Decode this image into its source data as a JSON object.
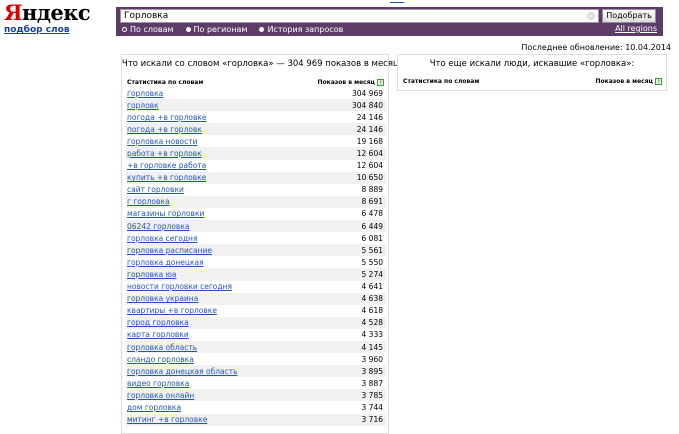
{
  "logo": {
    "word_first": "Я",
    "word_rest": "ндекс",
    "subtitle": "подбор слов"
  },
  "search": {
    "value": "Горловка",
    "button_label": "Подобрать",
    "modes": [
      {
        "label": "По словам",
        "selected": true
      },
      {
        "label": "По регионам",
        "selected": false
      },
      {
        "label": "История запросов",
        "selected": false
      }
    ],
    "all_regions_label": "All regions"
  },
  "last_update": "Последнее обновление: 10.04.2014",
  "left_panel": {
    "title": "Что искали со словом «горловка» — 304 969 показов в месяц",
    "col_query": "Статистика по словам",
    "col_shows": "Показов в месяц",
    "rows": [
      {
        "q": "горловка",
        "n": "304 969"
      },
      {
        "q": "горловк",
        "n": "304 840"
      },
      {
        "q": "погода +в горловке",
        "n": "24 146"
      },
      {
        "q": "погода +в горловк",
        "n": "24 146"
      },
      {
        "q": "горловка новости",
        "n": "19 168"
      },
      {
        "q": "работа +в горловк",
        "n": "12 604"
      },
      {
        "q": "+в горловке работа",
        "n": "12 604"
      },
      {
        "q": "купить +в горловке",
        "n": "10 650"
      },
      {
        "q": "сайт горловки",
        "n": "8 889"
      },
      {
        "q": "г горловка",
        "n": "8 691"
      },
      {
        "q": "магазины горловки",
        "n": "6 478"
      },
      {
        "q": "06242 горловка",
        "n": "6 449"
      },
      {
        "q": "горловка сегодня",
        "n": "6 081"
      },
      {
        "q": "горловка расписание",
        "n": "5 561"
      },
      {
        "q": "горловка донецкая",
        "n": "5 550"
      },
      {
        "q": "горловка юа",
        "n": "5 274"
      },
      {
        "q": "новости горловки сегодня",
        "n": "4 641"
      },
      {
        "q": "горловка украина",
        "n": "4 638"
      },
      {
        "q": "квартиры +в горловке",
        "n": "4 618"
      },
      {
        "q": "город горловка",
        "n": "4 528"
      },
      {
        "q": "карта горловки",
        "n": "4 333"
      },
      {
        "q": "горловка область",
        "n": "4 145"
      },
      {
        "q": "сландо горловка",
        "n": "3 960"
      },
      {
        "q": "горловка донецкая область",
        "n": "3 895"
      },
      {
        "q": "видео горловка",
        "n": "3 887"
      },
      {
        "q": "горловка онлайн",
        "n": "3 785"
      },
      {
        "q": "дом горловка",
        "n": "3 744"
      },
      {
        "q": "митинг +в горловке",
        "n": "3 716"
      }
    ]
  },
  "right_panel": {
    "title": "Что еще искали люди, искавшие «горловка»:",
    "col_query": "Статистика по словам",
    "col_shows": "Показов в месяц"
  }
}
